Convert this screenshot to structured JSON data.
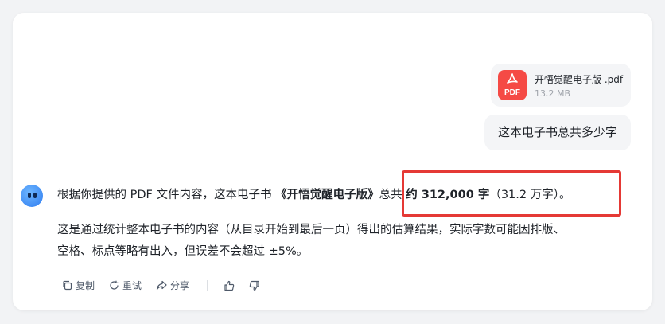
{
  "attachment": {
    "file_name": "开悟觉醒电子版 .pdf",
    "file_size": "13.2 MB",
    "type_label": "PDF"
  },
  "user_message": "这本电子书总共多少字",
  "answer": {
    "line1_prefix": "根据你提供的 PDF 文件内容，这本电子书 ",
    "book_title": "《开悟觉醒电子版》",
    "total_prefix": "总共 ",
    "total_value": "约 312,000 字",
    "total_alt": "（31.2 万字）",
    "line1_end": "。",
    "para_line1": "这是通过统计整本电子书的内容（从目录开始到最后一页）得出的估算结果，实际字数可能因排版、",
    "para_line2": "空格、标点等略有出入，但误差不会超过 ±5%。"
  },
  "actions": {
    "copy": "复制",
    "retry": "重试",
    "share": "分享"
  },
  "colors": {
    "highlight_border": "#e53935",
    "pdf_icon": "#f54a45",
    "avatar": "#2f7cf0"
  }
}
